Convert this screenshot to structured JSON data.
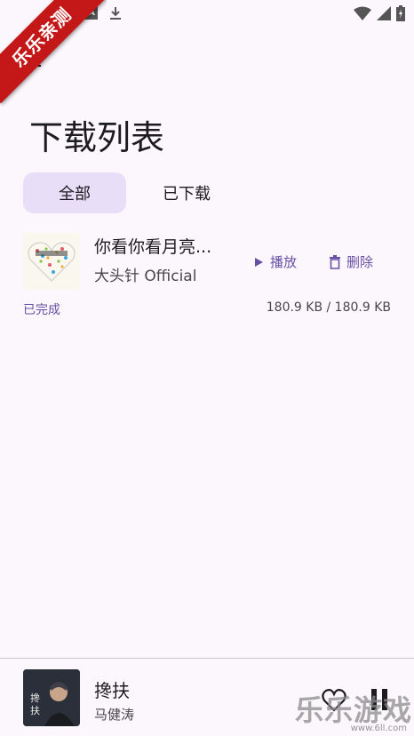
{
  "status_bar": {
    "left_icons": [
      "a-icon",
      "download-icon"
    ],
    "right_icons": [
      "wifi-icon",
      "signal-icon",
      "battery-charging-icon"
    ]
  },
  "ribbon": {
    "text": "乐乐亲测"
  },
  "page": {
    "title": "下载列表"
  },
  "tabs": [
    {
      "label": "全部",
      "active": true
    },
    {
      "label": "已下载",
      "active": false
    }
  ],
  "downloads": [
    {
      "title": "你看你看月亮...",
      "artist": "大头针 Official",
      "play_label": "播放",
      "delete_label": "删除",
      "status": "已完成",
      "size": "180.9 KB / 180.9 KB"
    }
  ],
  "mini_player": {
    "title": "搀扶",
    "artist": "马健涛"
  },
  "watermark": {
    "main": "乐乐游戏",
    "url": "www.6ll.com"
  },
  "colors": {
    "accent": "#6750A4",
    "tab_active_bg": "#E8DEF8",
    "background": "#FCF7FC",
    "ribbon": "#C41818"
  }
}
